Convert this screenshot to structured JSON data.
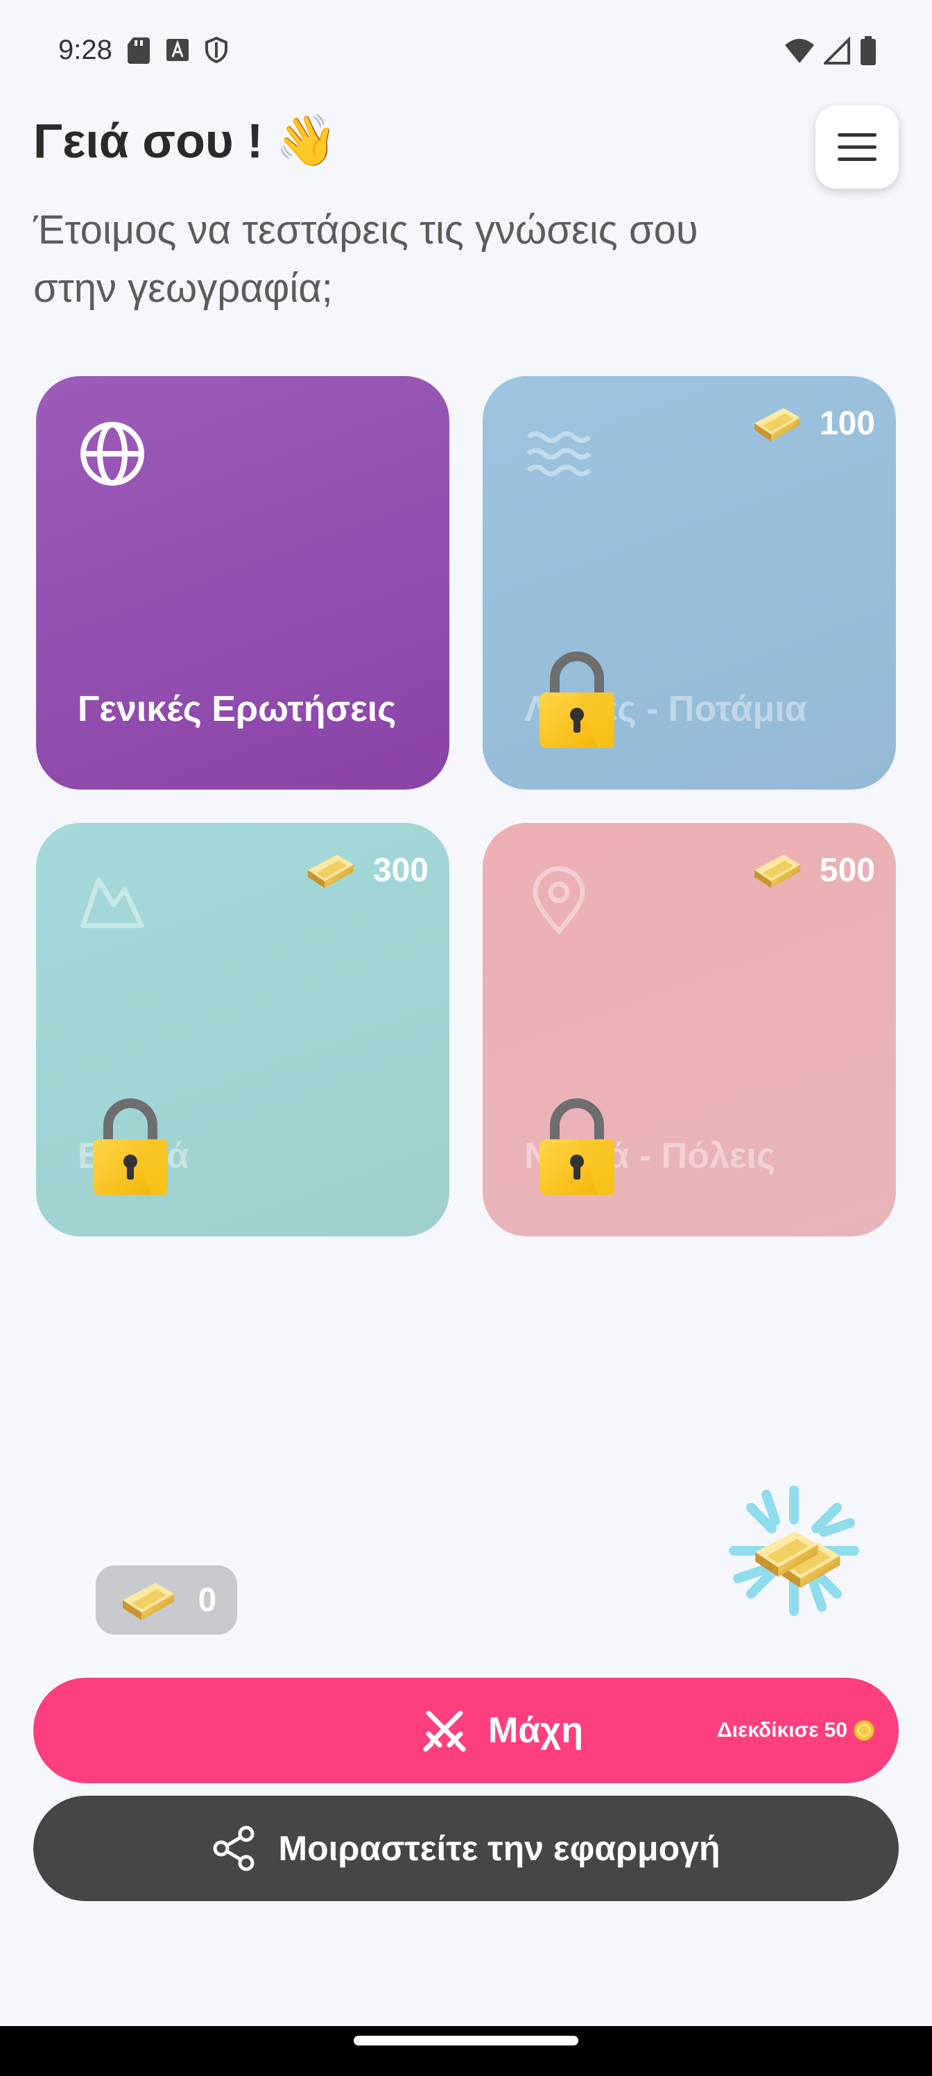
{
  "status_bar": {
    "time": "9:28",
    "left_icons": [
      "sd-card-icon",
      "font-a-icon",
      "shield-icon"
    ],
    "right_icons": [
      "wifi-icon",
      "signal-icon",
      "battery-icon"
    ]
  },
  "header": {
    "greeting": "Γειά σου !",
    "wave_emoji": "👋",
    "subtitle": "Έτοιμος να τεστάρεις τις γνώσεις σου στην γεωγραφία;",
    "menu_icon": "hamburger-menu-icon"
  },
  "categories": [
    {
      "label": "Γενικές Ερωτήσεις",
      "icon": "globe-icon",
      "locked": false,
      "price": null,
      "color": "#9552b0"
    },
    {
      "label": "Λίμνες - Ποτάμια",
      "icon": "waves-icon",
      "locked": true,
      "price": "100",
      "color": "#97bcd9"
    },
    {
      "label": "Βουνά",
      "icon": "mountain-icon",
      "locked": true,
      "price": "300",
      "color": "#a2d3d3"
    },
    {
      "label": "Νησιά - Πόλεις",
      "icon": "location-pin-icon",
      "locked": true,
      "price": "500",
      "color": "#e9b2b6"
    }
  ],
  "coins": {
    "value": "0",
    "icon": "gold-bar-icon"
  },
  "bonus": {
    "icon": "gold-bars-reward-icon"
  },
  "battle": {
    "label": "Μάχη",
    "icon": "crossed-swords-icon",
    "claim_text": "Διεκδίκισε 50",
    "claim_icon": "coin-icon",
    "color": "#fd3f7f"
  },
  "share": {
    "label": "Μοιραστείτε την εφαρμογή",
    "icon": "share-icon",
    "color": "#474645"
  }
}
